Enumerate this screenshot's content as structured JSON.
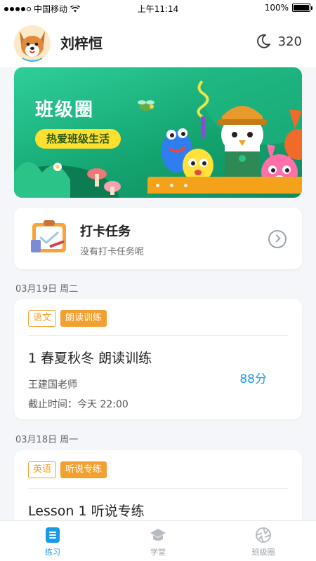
{
  "status_bar": {
    "carrier": "中国移动",
    "time": "上午11:14",
    "battery": "100%"
  },
  "header": {
    "username": "刘梓恒",
    "coins": "320",
    "avatar_icon": "dog-avatar-icon",
    "coin_icon": "moon-icon"
  },
  "banner": {
    "title": "班级圈",
    "subtitle": "热爱班级生活"
  },
  "task": {
    "title": "打卡任务",
    "subtitle": "没有打卡任务呢"
  },
  "homework": [
    {
      "date": "03月19日 周二",
      "tag_subject": "语文",
      "tag_type": "朗读训练",
      "title": "1 春夏秋冬 朗读训练",
      "teacher": "王建国老师",
      "deadline": "截止时间：今天 22:00",
      "score": "88分"
    },
    {
      "date": "03月18日 周一",
      "tag_subject": "英语",
      "tag_type": "听说专练",
      "title": "Lesson 1 听说专练"
    }
  ],
  "tabbar": {
    "tabs": [
      {
        "label": "练习",
        "icon": "practice-icon",
        "active": true
      },
      {
        "label": "学堂",
        "icon": "graduation-cap-icon",
        "active": false
      },
      {
        "label": "班级圈",
        "icon": "shutter-icon",
        "active": false
      }
    ]
  },
  "colors": {
    "accent": "#1a9be6",
    "tag_orange": "#f3a030",
    "banner_green": "#13a36f"
  }
}
